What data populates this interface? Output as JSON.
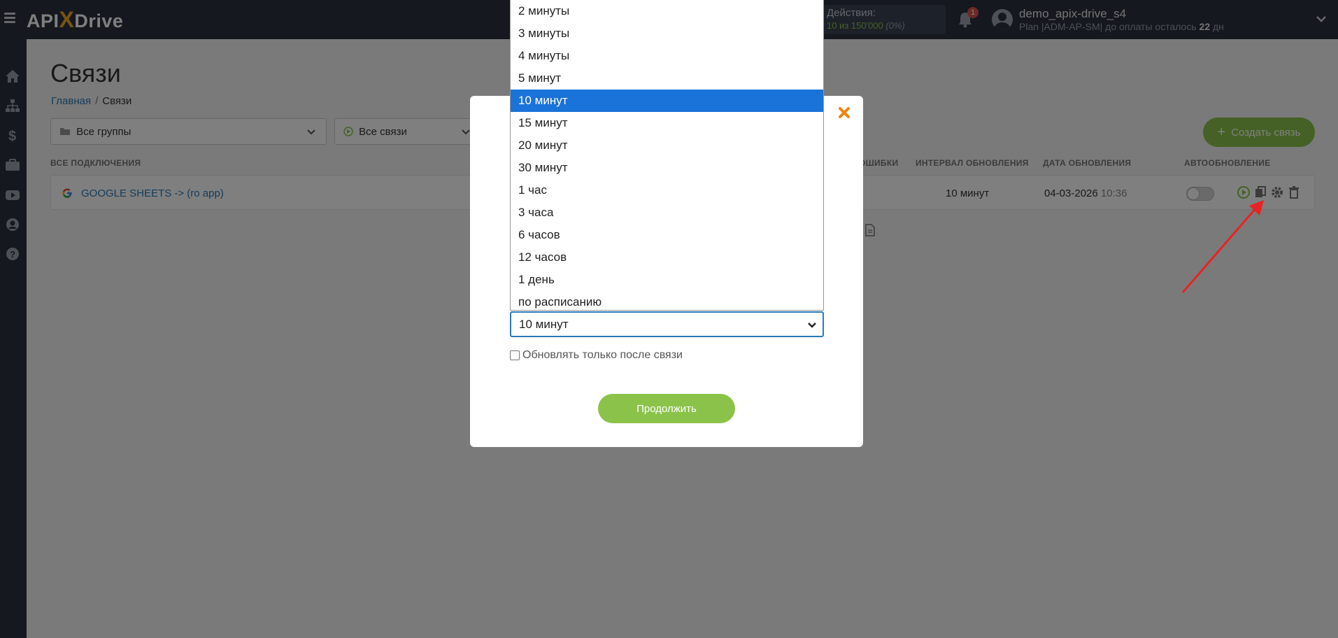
{
  "header": {
    "logo_main": "API",
    "logo_x": "X",
    "logo_tail": "Drive",
    "actions_label": "Действия:",
    "actions_used": "10 из 150'000",
    "actions_percent": "(0%)",
    "notifications_count": "1",
    "user_name": "demo_apix-drive_s4",
    "plan_prefix": "Plan |ADM-AP-SM| до оплаты осталось ",
    "plan_days": "22",
    "plan_suffix": " дн"
  },
  "sidebar": {
    "items": [
      "home-icon",
      "sitemap-icon",
      "dollar-icon",
      "briefcase-icon",
      "youtube-icon",
      "user-icon",
      "help-icon"
    ]
  },
  "page": {
    "title": "Связи",
    "breadcrumb_home": "Главная",
    "breadcrumb_sep": "/",
    "breadcrumb_current": "Связи",
    "filter_groups": "Все группы",
    "filter_connections": "Все связи",
    "create_button": "Создать связь"
  },
  "table": {
    "headers": {
      "all": "ВСЕ ПОДКЛЮЧЕНИЯ",
      "errors": "ОШИБКИ",
      "interval": "ИНТЕРВАЛ ОБНОВЛЕНИЯ",
      "date": "ДАТА ОБНОВЛЕНИЯ",
      "auto": "АВТООБНОВЛЕНИЕ"
    },
    "row": {
      "name": "GOOGLE SHEETS -> (ro app)",
      "interval": "10 минут",
      "date": "04-03-2026",
      "time": "10:36",
      "autoupdate_on": false
    }
  },
  "modal": {
    "select_value": "10 минут",
    "checkbox_label": "Обновлять только после связи",
    "checkbox_checked": false,
    "continue_button": "Продолжить"
  },
  "dropdown": {
    "options": [
      "2 минуты",
      "3 минуты",
      "4 минуты",
      "5 минут",
      "10 минут",
      "15 минут",
      "20 минут",
      "30 минут",
      "1 час",
      "3 часа",
      "6 часов",
      "12 часов",
      "1 день",
      "по расписанию"
    ],
    "selected": "10 минут"
  },
  "colors": {
    "topbar": "#2a313d",
    "accent_green": "#8bc34a",
    "link_blue": "#2a7ab8",
    "selected_blue": "#1a73d9",
    "close_orange": "#f0830d",
    "arrow_red": "#e82323"
  }
}
